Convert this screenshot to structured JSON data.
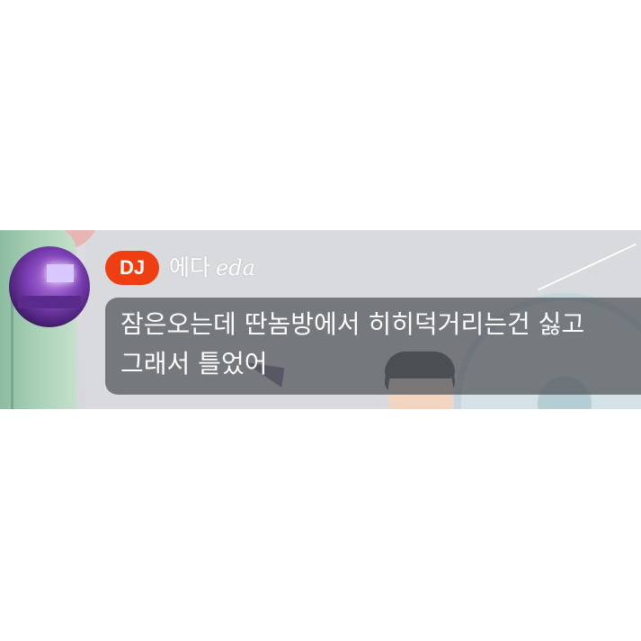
{
  "message": {
    "badge": "DJ",
    "username": "에다",
    "username_script": "eda",
    "lines": [
      "잠은오는데 딴놈방에서 히히덕거리는건 싫고",
      "그래서 틀었어"
    ]
  },
  "colors": {
    "badge_bg": "#ef3f12",
    "bubble_bg": "#585c60",
    "text": "#ffffff"
  }
}
